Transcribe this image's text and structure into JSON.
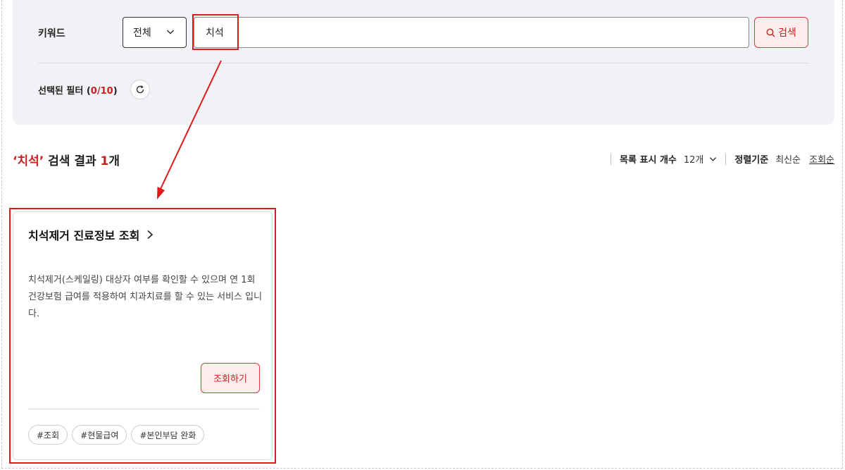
{
  "filter": {
    "keyword_label": "키워드",
    "scope_value": "전체",
    "search_value": "치석",
    "search_button": "검색",
    "selected_filter_prefix": "선택된 필터 (",
    "selected_filter_count": "0/10",
    "selected_filter_suffix": ")"
  },
  "results": {
    "quote_open": "‘",
    "keyword": "치석",
    "quote_close": "’",
    "text_middle": " 검색 결과 ",
    "count": "1",
    "unit": "개"
  },
  "list_controls": {
    "page_size_label": "목록 표시 개수",
    "page_size_value": "12개",
    "sort_label": "정렬기준",
    "sort_options": [
      "최신순",
      "조회순"
    ],
    "active_sort": "조회순"
  },
  "card": {
    "title": "치석제거 진료정보 조회",
    "description": "치석제거(스케일링) 대상자 여부를 확인할 수 있으며 연 1회 건강보험 급여를 적용하여 치과치료를 할 수 있는 서비스 입니다.",
    "button": "조회하기",
    "tags": [
      "#조회",
      "#현물급여",
      "#본인부담 완화"
    ]
  },
  "colors": {
    "accent_red": "#c81f1f",
    "annotation_red": "#e01a1a",
    "panel_bg": "#f0f2f5"
  }
}
